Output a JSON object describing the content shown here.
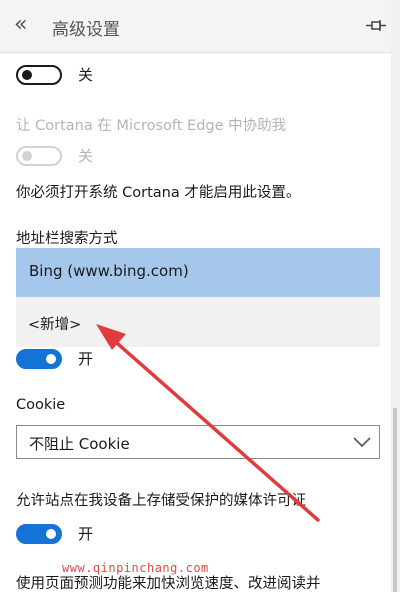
{
  "header": {
    "back_icon": "«",
    "title": "高级设置",
    "pin_icon": "pin-icon"
  },
  "settings": {
    "toggle1_state": "关",
    "cortana_label": "让 Cortana 在 Microsoft Edge 中协助我",
    "cortana_state": "关",
    "cortana_note": "你必须打开系统 Cortana 才能启用此设置。",
    "address_search_label": "地址栏搜索方式",
    "search_options": [
      "Bing (www.bing.com)",
      "<新增>"
    ],
    "toggle2_state": "开",
    "cookie_label": "Cookie",
    "cookie_value": "不阻止 Cookie",
    "media_license_label": "允许站点在我设备上存储受保护的媒体许可证",
    "media_license_state": "开",
    "prediction_text": "使用页面预测功能来加快浏览速度、改进阅读并"
  },
  "watermark": "www.qinpinchang.com",
  "colors": {
    "accent": "#1473d6",
    "selected_bg": "#a5c7ec",
    "arrow": "#e03c3c"
  }
}
